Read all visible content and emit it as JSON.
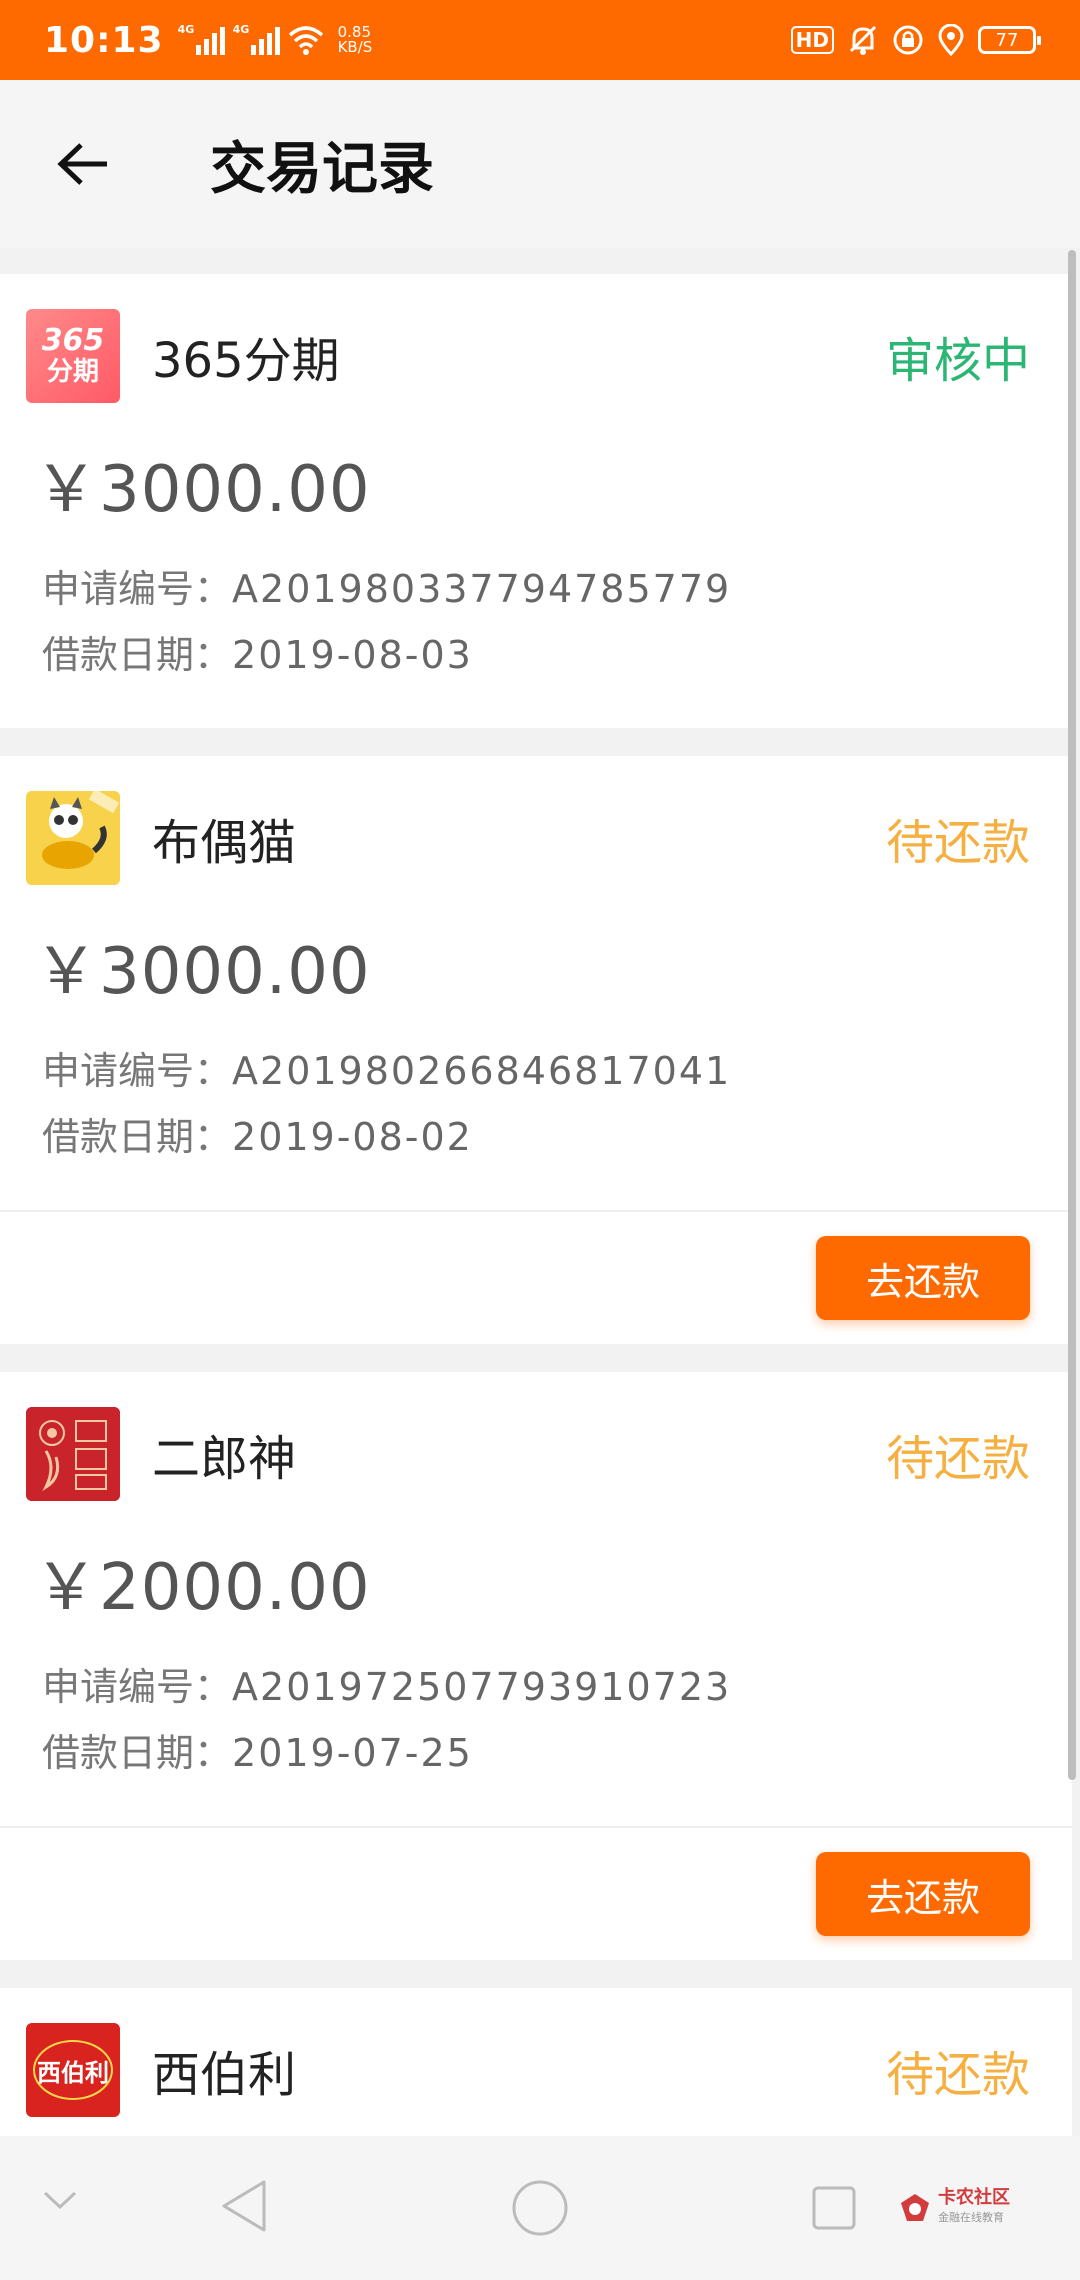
{
  "status_bar": {
    "time": "10:13",
    "net_speed_value": "0.85",
    "net_speed_unit": "KB/S",
    "signal_label": "4G",
    "hd_label": "HD",
    "battery": "77"
  },
  "header": {
    "title": "交易记录"
  },
  "records": [
    {
      "lender": "365分期",
      "logo_text_top": "365",
      "logo_text_bottom": "分期",
      "status": "审核中",
      "amount": "￥3000.00",
      "app_no_label": "申请编号：",
      "app_no": "A201980337794785779",
      "date_label": "借款日期：",
      "date": "2019-08-03"
    },
    {
      "lender": "布偶猫",
      "status": "待还款",
      "amount": "￥3000.00",
      "app_no_label": "申请编号：",
      "app_no": "A201980266846817041",
      "date_label": "借款日期：",
      "date": "2019-08-02",
      "action": "去还款"
    },
    {
      "lender": "二郎神",
      "status": "待还款",
      "amount": "￥2000.00",
      "app_no_label": "申请编号：",
      "app_no": "A201972507793910723",
      "date_label": "借款日期：",
      "date": "2019-07-25",
      "action": "去还款"
    },
    {
      "lender": "西伯利",
      "logo_text": "西伯利",
      "status": "待还款"
    }
  ],
  "watermark": {
    "title": "卡农社区",
    "subtitle": "金融在线教育"
  },
  "colors": {
    "accent": "#ff6a00",
    "status_review": "#2bb673",
    "status_pending": "#f5b041"
  }
}
